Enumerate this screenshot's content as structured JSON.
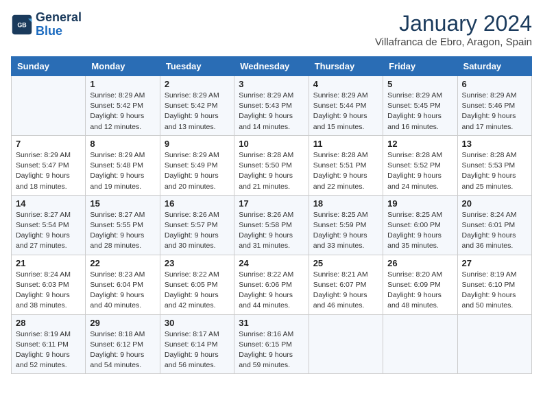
{
  "logo": {
    "line1": "General",
    "line2": "Blue"
  },
  "title": "January 2024",
  "subtitle": "Villafranca de Ebro, Aragon, Spain",
  "weekdays": [
    "Sunday",
    "Monday",
    "Tuesday",
    "Wednesday",
    "Thursday",
    "Friday",
    "Saturday"
  ],
  "weeks": [
    [
      {
        "day": "",
        "info": ""
      },
      {
        "day": "1",
        "info": "Sunrise: 8:29 AM\nSunset: 5:42 PM\nDaylight: 9 hours\nand 12 minutes."
      },
      {
        "day": "2",
        "info": "Sunrise: 8:29 AM\nSunset: 5:42 PM\nDaylight: 9 hours\nand 13 minutes."
      },
      {
        "day": "3",
        "info": "Sunrise: 8:29 AM\nSunset: 5:43 PM\nDaylight: 9 hours\nand 14 minutes."
      },
      {
        "day": "4",
        "info": "Sunrise: 8:29 AM\nSunset: 5:44 PM\nDaylight: 9 hours\nand 15 minutes."
      },
      {
        "day": "5",
        "info": "Sunrise: 8:29 AM\nSunset: 5:45 PM\nDaylight: 9 hours\nand 16 minutes."
      },
      {
        "day": "6",
        "info": "Sunrise: 8:29 AM\nSunset: 5:46 PM\nDaylight: 9 hours\nand 17 minutes."
      }
    ],
    [
      {
        "day": "7",
        "info": "Sunrise: 8:29 AM\nSunset: 5:47 PM\nDaylight: 9 hours\nand 18 minutes."
      },
      {
        "day": "8",
        "info": "Sunrise: 8:29 AM\nSunset: 5:48 PM\nDaylight: 9 hours\nand 19 minutes."
      },
      {
        "day": "9",
        "info": "Sunrise: 8:29 AM\nSunset: 5:49 PM\nDaylight: 9 hours\nand 20 minutes."
      },
      {
        "day": "10",
        "info": "Sunrise: 8:28 AM\nSunset: 5:50 PM\nDaylight: 9 hours\nand 21 minutes."
      },
      {
        "day": "11",
        "info": "Sunrise: 8:28 AM\nSunset: 5:51 PM\nDaylight: 9 hours\nand 22 minutes."
      },
      {
        "day": "12",
        "info": "Sunrise: 8:28 AM\nSunset: 5:52 PM\nDaylight: 9 hours\nand 24 minutes."
      },
      {
        "day": "13",
        "info": "Sunrise: 8:28 AM\nSunset: 5:53 PM\nDaylight: 9 hours\nand 25 minutes."
      }
    ],
    [
      {
        "day": "14",
        "info": "Sunrise: 8:27 AM\nSunset: 5:54 PM\nDaylight: 9 hours\nand 27 minutes."
      },
      {
        "day": "15",
        "info": "Sunrise: 8:27 AM\nSunset: 5:55 PM\nDaylight: 9 hours\nand 28 minutes."
      },
      {
        "day": "16",
        "info": "Sunrise: 8:26 AM\nSunset: 5:57 PM\nDaylight: 9 hours\nand 30 minutes."
      },
      {
        "day": "17",
        "info": "Sunrise: 8:26 AM\nSunset: 5:58 PM\nDaylight: 9 hours\nand 31 minutes."
      },
      {
        "day": "18",
        "info": "Sunrise: 8:25 AM\nSunset: 5:59 PM\nDaylight: 9 hours\nand 33 minutes."
      },
      {
        "day": "19",
        "info": "Sunrise: 8:25 AM\nSunset: 6:00 PM\nDaylight: 9 hours\nand 35 minutes."
      },
      {
        "day": "20",
        "info": "Sunrise: 8:24 AM\nSunset: 6:01 PM\nDaylight: 9 hours\nand 36 minutes."
      }
    ],
    [
      {
        "day": "21",
        "info": "Sunrise: 8:24 AM\nSunset: 6:03 PM\nDaylight: 9 hours\nand 38 minutes."
      },
      {
        "day": "22",
        "info": "Sunrise: 8:23 AM\nSunset: 6:04 PM\nDaylight: 9 hours\nand 40 minutes."
      },
      {
        "day": "23",
        "info": "Sunrise: 8:22 AM\nSunset: 6:05 PM\nDaylight: 9 hours\nand 42 minutes."
      },
      {
        "day": "24",
        "info": "Sunrise: 8:22 AM\nSunset: 6:06 PM\nDaylight: 9 hours\nand 44 minutes."
      },
      {
        "day": "25",
        "info": "Sunrise: 8:21 AM\nSunset: 6:07 PM\nDaylight: 9 hours\nand 46 minutes."
      },
      {
        "day": "26",
        "info": "Sunrise: 8:20 AM\nSunset: 6:09 PM\nDaylight: 9 hours\nand 48 minutes."
      },
      {
        "day": "27",
        "info": "Sunrise: 8:19 AM\nSunset: 6:10 PM\nDaylight: 9 hours\nand 50 minutes."
      }
    ],
    [
      {
        "day": "28",
        "info": "Sunrise: 8:19 AM\nSunset: 6:11 PM\nDaylight: 9 hours\nand 52 minutes."
      },
      {
        "day": "29",
        "info": "Sunrise: 8:18 AM\nSunset: 6:12 PM\nDaylight: 9 hours\nand 54 minutes."
      },
      {
        "day": "30",
        "info": "Sunrise: 8:17 AM\nSunset: 6:14 PM\nDaylight: 9 hours\nand 56 minutes."
      },
      {
        "day": "31",
        "info": "Sunrise: 8:16 AM\nSunset: 6:15 PM\nDaylight: 9 hours\nand 59 minutes."
      },
      {
        "day": "",
        "info": ""
      },
      {
        "day": "",
        "info": ""
      },
      {
        "day": "",
        "info": ""
      }
    ]
  ]
}
